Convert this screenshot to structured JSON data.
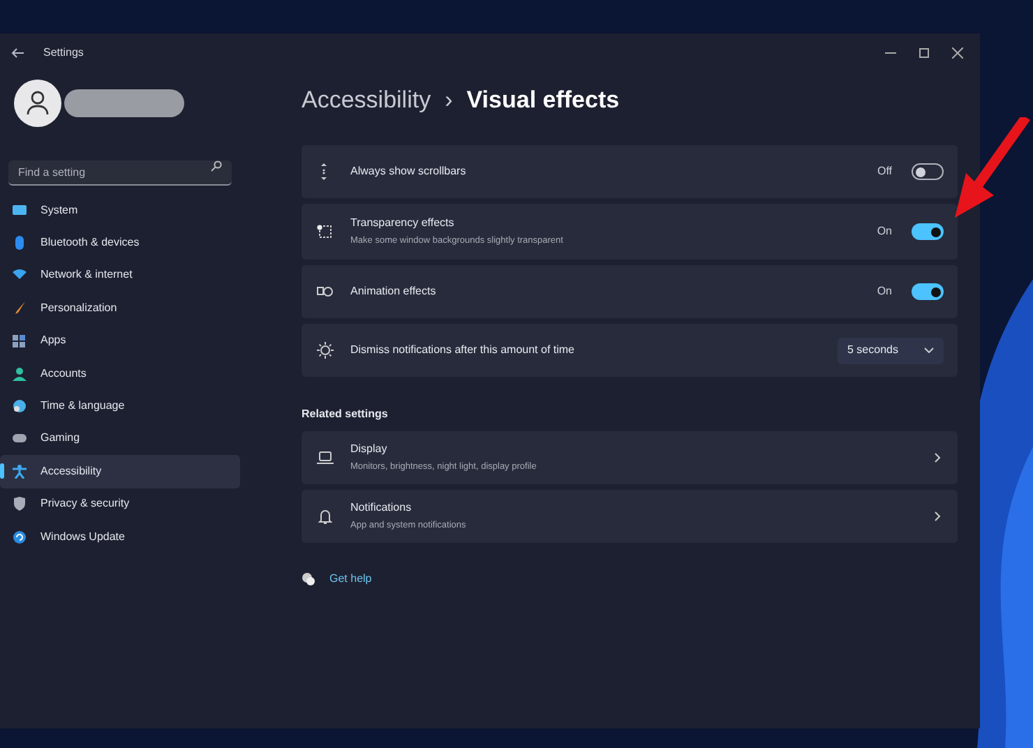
{
  "window": {
    "title": "Settings"
  },
  "search": {
    "placeholder": "Find a setting"
  },
  "nav": [
    {
      "label": "System",
      "selected": false
    },
    {
      "label": "Bluetooth & devices",
      "selected": false
    },
    {
      "label": "Network & internet",
      "selected": false
    },
    {
      "label": "Personalization",
      "selected": false
    },
    {
      "label": "Apps",
      "selected": false
    },
    {
      "label": "Accounts",
      "selected": false
    },
    {
      "label": "Time & language",
      "selected": false
    },
    {
      "label": "Gaming",
      "selected": false
    },
    {
      "label": "Accessibility",
      "selected": true
    },
    {
      "label": "Privacy & security",
      "selected": false
    },
    {
      "label": "Windows Update",
      "selected": false
    }
  ],
  "breadcrumb": {
    "parent": "Accessibility",
    "separator": "›",
    "current": "Visual effects"
  },
  "settings": [
    {
      "kind": "toggle",
      "title": "Always show scrollbars",
      "state_label": "Off",
      "on": false
    },
    {
      "kind": "toggle",
      "title": "Transparency effects",
      "subtitle": "Make some window backgrounds slightly transparent",
      "state_label": "On",
      "on": true
    },
    {
      "kind": "toggle",
      "title": "Animation effects",
      "state_label": "On",
      "on": true
    },
    {
      "kind": "dropdown",
      "title": "Dismiss notifications after this amount of time",
      "value": "5 seconds"
    }
  ],
  "related": {
    "heading": "Related settings",
    "items": [
      {
        "title": "Display",
        "subtitle": "Monitors, brightness, night light, display profile"
      },
      {
        "title": "Notifications",
        "subtitle": "App and system notifications"
      }
    ]
  },
  "help": {
    "label": "Get help"
  }
}
